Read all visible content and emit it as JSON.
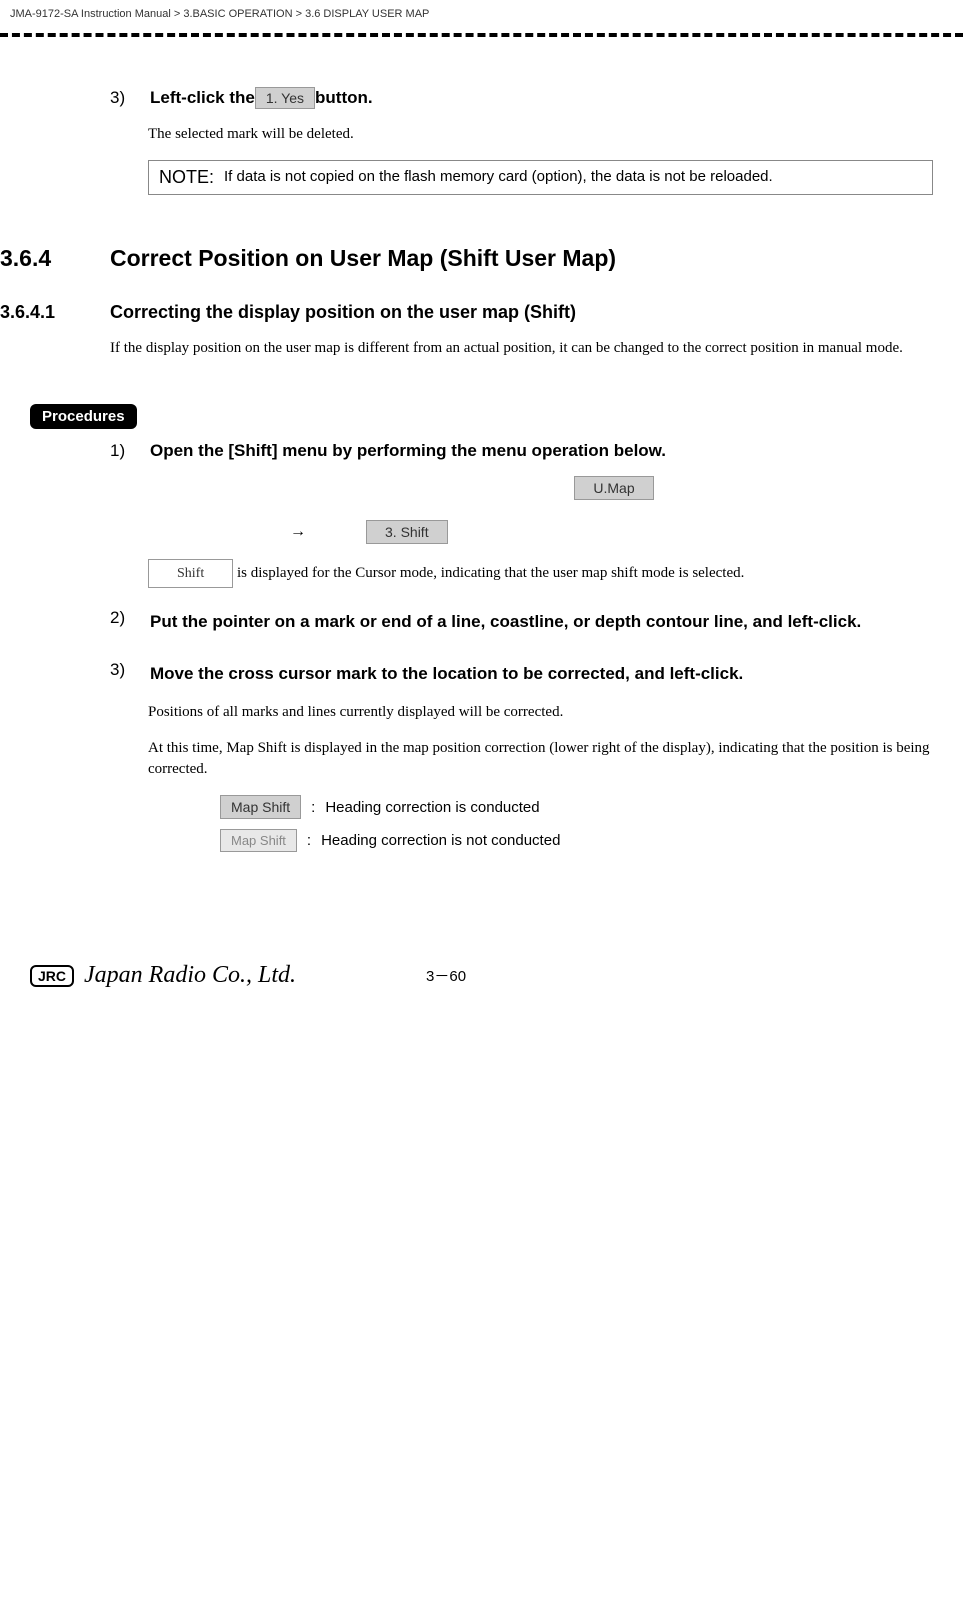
{
  "breadcrumb": "JMA-9172-SA Instruction Manual > 3.BASIC OPERATION > 3.6  DISPLAY USER MAP",
  "step3a": {
    "num": "3)",
    "prefix": "Left-click the ",
    "button": "1. Yes",
    "suffix": " button."
  },
  "selectedMarkText": "The selected mark will be deleted.",
  "note": {
    "label": "NOTE:",
    "text": "If data is not copied on the flash memory card (option), the data is not be reloaded."
  },
  "section": {
    "num": "3.6.4",
    "title": "Correct Position on User Map (Shift User Map)"
  },
  "subsection": {
    "num": "3.6.4.1",
    "title": "Correcting the display position on the user map (Shift)"
  },
  "subsectionBody": "If the display position on the user map is different from an actual position, it can be changed to the correct position in manual mode.",
  "procedures": "Procedures",
  "step1": {
    "num": "1)",
    "text": "Open the [Shift] menu by performing the menu operation below.",
    "umap": "U.Map",
    "arrow": "→",
    "shiftMenu": "3. Shift",
    "shiftBtn": "Shift",
    "shiftText": " is displayed for the  Cursor  mode, indicating that the user map shift mode is selected."
  },
  "step2": {
    "num": "2)",
    "text": "Put the pointer on a mark or end of a line, coastline, or depth contour line, and left-click."
  },
  "step3": {
    "num": "3)",
    "text": "Move the cross cursor mark to the location to be corrected, and left-click.",
    "body1": "Positions of all marks and lines currently displayed will be corrected.",
    "body2": "At this time,  Map Shift  is displayed in the map position correction (lower right of the display), indicating that the position is being corrected."
  },
  "legend": {
    "active": "Map Shift",
    "activeText": "Heading correction is conducted",
    "inactive": "Map Shift",
    "inactiveText": "Heading correction is not conducted",
    "colon": ":"
  },
  "footer": {
    "jrc": "JRC",
    "company": "Japan Radio Co., Ltd.",
    "page": "3－60"
  }
}
